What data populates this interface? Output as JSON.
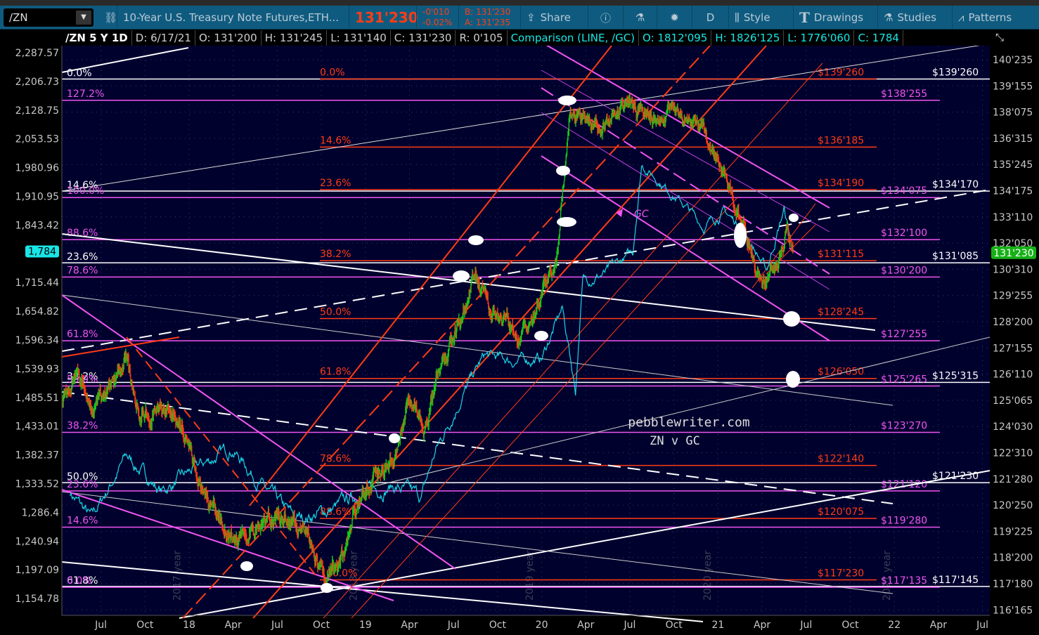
{
  "toolbar": {
    "symbol": "/ZN",
    "description": "10-Year U.S. Treasury Note Futures,ETH...",
    "last": "131'230",
    "change": "-0'010",
    "change_pct": "-0.02%",
    "bid": "B: 131'230",
    "ask": "A: 131'235",
    "share": "Share",
    "period": "D",
    "style": "Style",
    "drawings": "Drawings",
    "studies": "Studies",
    "patterns": "Patterns"
  },
  "header": {
    "title": "/ZN 5 Y 1D",
    "date": "D: 6/17/21",
    "open": "O: 131'200",
    "high": "H: 131'245",
    "low": "L: 131'140",
    "close": "C: 131'230",
    "range": "R: 0'105",
    "comparison": "Comparison (LINE, /GC)",
    "cmp_open": "O: 1812'095",
    "cmp_high": "H: 1826'125",
    "cmp_low": "L: 1776'060",
    "cmp_close": "C: 1784"
  },
  "colors": {
    "bg": "#01012e",
    "up": "#19c819",
    "down": "#ff3c14",
    "gc": "#19d6e6",
    "magenta": "#f055f0",
    "orange": "#ff3c14",
    "white": "#ffffff"
  },
  "watermark": {
    "site": "pebblewriter.com",
    "subtitle": "ZN v GC",
    "gc_label": "GC"
  },
  "chart_data": {
    "type": "line",
    "title": "/ZN 5 Y 1D vs /GC",
    "x_ticks": [
      "Jul",
      "Oct",
      "18",
      "Apr",
      "Jul",
      "Oct",
      "19",
      "Apr",
      "Jul",
      "Oct",
      "20",
      "Apr",
      "Jul",
      "Oct",
      "21",
      "Apr",
      "Jul",
      "Oct",
      "22",
      "Apr",
      "Jul"
    ],
    "x_tick_months": [
      -6,
      -3,
      0,
      3,
      6,
      9,
      12,
      15,
      18,
      21,
      24,
      27,
      30,
      33,
      36,
      39,
      42,
      45,
      48,
      51,
      54
    ],
    "year_marks": [
      {
        "label": "2017 year",
        "m": -0.6
      },
      {
        "label": "2018 year",
        "m": 11.4
      },
      {
        "label": "2019 year",
        "m": 23.4
      },
      {
        "label": "2020 year",
        "m": 35.5
      },
      {
        "label": "2021 year",
        "m": 47.7
      }
    ],
    "right_axis": {
      "labels": [
        "140'235",
        "139'155",
        "138'075",
        "136'315",
        "135'245",
        "134'175",
        "133'110",
        "132'050",
        "130'310",
        "129'255",
        "128'200",
        "127'155",
        "126'110",
        "125'065",
        "124'030",
        "122'310",
        "121'280",
        "120'250",
        "119'225",
        "118'200",
        "117'180",
        "116'165"
      ],
      "values": [
        140.734,
        139.484,
        138.234,
        136.984,
        135.766,
        134.547,
        133.344,
        132.156,
        130.969,
        129.797,
        128.625,
        127.484,
        126.344,
        125.203,
        124.094,
        122.969,
        121.875,
        120.781,
        119.703,
        118.625,
        117.563,
        116.516
      ],
      "last_badge": "131'230"
    },
    "left_axis": {
      "labels": [
        "2,287.57",
        "2,206.73",
        "2,128.75",
        "2,053.53",
        "1,980.96",
        "1,910.95",
        "1,843.42",
        "",
        "1,715.44",
        "1,654.82",
        "1,596.34",
        "1,539.93",
        "1,485.51",
        "1,433.01",
        "1,382.37",
        "1,333.52",
        "1,286.4",
        "1,240.94",
        "1,197.09",
        "1,154.78"
      ],
      "values": [
        2287.57,
        2206.73,
        2128.75,
        2053.53,
        1980.96,
        1910.95,
        1843.42,
        1778,
        1715.44,
        1654.82,
        1596.34,
        1539.93,
        1485.51,
        1433.01,
        1382.37,
        1333.52,
        1286.4,
        1240.94,
        1197.09,
        1154.78
      ],
      "last_badge": "1,784"
    },
    "series": [
      {
        "name": "/ZN",
        "style": "candles",
        "points_month_price": [
          [
            -8.6,
            125.3
          ],
          [
            -7.5,
            126.2
          ],
          [
            -6.5,
            124.8
          ],
          [
            -4.3,
            127.0
          ],
          [
            -3.3,
            124.5
          ],
          [
            -2,
            124.8
          ],
          [
            -0.5,
            124.3
          ],
          [
            1,
            121.0
          ],
          [
            3.5,
            119.3
          ],
          [
            5,
            120.3
          ],
          [
            6.5,
            120.0
          ],
          [
            8,
            119.7
          ],
          [
            9.3,
            117.6
          ],
          [
            10.5,
            118.8
          ],
          [
            11.5,
            121.0
          ],
          [
            13,
            122.2
          ],
          [
            14,
            122.8
          ],
          [
            15,
            125.5
          ],
          [
            16,
            124.0
          ],
          [
            17,
            126.5
          ],
          [
            18.5,
            128.5
          ],
          [
            19.5,
            131.0
          ],
          [
            20.5,
            129.0
          ],
          [
            21.5,
            128.8
          ],
          [
            22.5,
            127.6
          ],
          [
            23.5,
            129.0
          ],
          [
            25,
            131.5
          ],
          [
            25.9,
            138.1
          ],
          [
            27,
            137.8
          ],
          [
            28,
            137.4
          ],
          [
            29,
            138.2
          ],
          [
            30,
            138.8
          ],
          [
            31,
            138.3
          ],
          [
            32,
            138.0
          ],
          [
            33,
            138.4
          ],
          [
            34,
            137.8
          ],
          [
            35,
            137.3
          ],
          [
            36,
            136.0
          ],
          [
            37,
            134.3
          ],
          [
            38,
            132.0
          ],
          [
            39,
            130.0
          ],
          [
            40,
            131.0
          ],
          [
            40.7,
            133.0
          ],
          [
            41.1,
            131.72
          ]
        ]
      },
      {
        "name": "/GC",
        "style": "line",
        "points_month_price": [
          [
            -8.1,
            1320
          ],
          [
            -6.65,
            1275
          ],
          [
            -4.26,
            1380
          ],
          [
            -1.87,
            1320
          ],
          [
            0.53,
            1360
          ],
          [
            2.9,
            1395
          ],
          [
            5.3,
            1320
          ],
          [
            7.2,
            1275
          ],
          [
            9.6,
            1290
          ],
          [
            12,
            1320
          ],
          [
            13.9,
            1330
          ],
          [
            15.8,
            1310
          ],
          [
            16.8,
            1390
          ],
          [
            18.7,
            1495
          ],
          [
            20.1,
            1565
          ],
          [
            22,
            1555
          ],
          [
            24,
            1560
          ],
          [
            25.4,
            1660
          ],
          [
            26.3,
            1500
          ],
          [
            26.8,
            1720
          ],
          [
            28.3,
            1735
          ],
          [
            30.2,
            1780
          ],
          [
            30.8,
            1990
          ],
          [
            32.1,
            1945
          ],
          [
            34,
            1880
          ],
          [
            35,
            1840
          ],
          [
            36.4,
            1875
          ],
          [
            37.8,
            1830
          ],
          [
            39.3,
            1740
          ],
          [
            40.5,
            1880
          ],
          [
            41.1,
            1784
          ]
        ]
      }
    ],
    "fib_white": [
      {
        "pct": "0.0%",
        "price": 139.8125,
        "tag": "$139'260"
      },
      {
        "pct": "14.6%",
        "price": 134.531,
        "tag": "$134'170"
      },
      {
        "pct": "23.6%",
        "price": 131.266,
        "tag": "$131'085"
      },
      {
        "pct": "38.2%",
        "price": 125.984,
        "tag": "$125'315"
      },
      {
        "pct": "50.0%",
        "price": 121.719,
        "tag": "$121'230"
      },
      {
        "pct": "61.8%",
        "price": 117.453,
        "tag": "$117'145"
      }
    ],
    "fib_magenta": [
      {
        "pct": "127.2%",
        "price": 138.797,
        "tag": "$138'255"
      },
      {
        "pct": "100.0%",
        "price": 134.234,
        "tag": "$134'075"
      },
      {
        "pct": "88.6%",
        "price": 132.3125,
        "tag": "$132'100"
      },
      {
        "pct": "78.6%",
        "price": 130.625,
        "tag": "$130'200"
      },
      {
        "pct": "61.8%",
        "price": 127.797,
        "tag": "$127'255"
      },
      {
        "pct": "50.0%",
        "price": 125.828,
        "tag": "$125'265"
      },
      {
        "pct": "38.2%",
        "price": 123.844,
        "tag": "$123'270"
      },
      {
        "pct": "23.6%",
        "price": 121.375,
        "tag": "$121'120"
      },
      {
        "pct": "14.6%",
        "price": 119.875,
        "tag": "$119'280"
      },
      {
        "pct": "0.0%",
        "price": 117.422,
        "tag": "$117'135"
      }
    ],
    "fib_orange": [
      {
        "pct": "0.0%",
        "price": 139.8125,
        "tag": "$139'260"
      },
      {
        "pct": "14.6%",
        "price": 136.578,
        "tag": "$136'185"
      },
      {
        "pct": "23.6%",
        "price": 134.594,
        "tag": "$134'190"
      },
      {
        "pct": "38.2%",
        "price": 131.359,
        "tag": "$131'115"
      },
      {
        "pct": "50.0%",
        "price": 128.766,
        "tag": "$128'245"
      },
      {
        "pct": "61.8%",
        "price": 126.156,
        "tag": "$126'050"
      },
      {
        "pct": "78.6%",
        "price": 122.4375,
        "tag": "$122'140"
      },
      {
        "pct": "88.6%",
        "price": 120.234,
        "tag": "$120'075"
      },
      {
        "pct": "100.0%",
        "price": 117.719,
        "tag": "$117'230"
      }
    ]
  }
}
